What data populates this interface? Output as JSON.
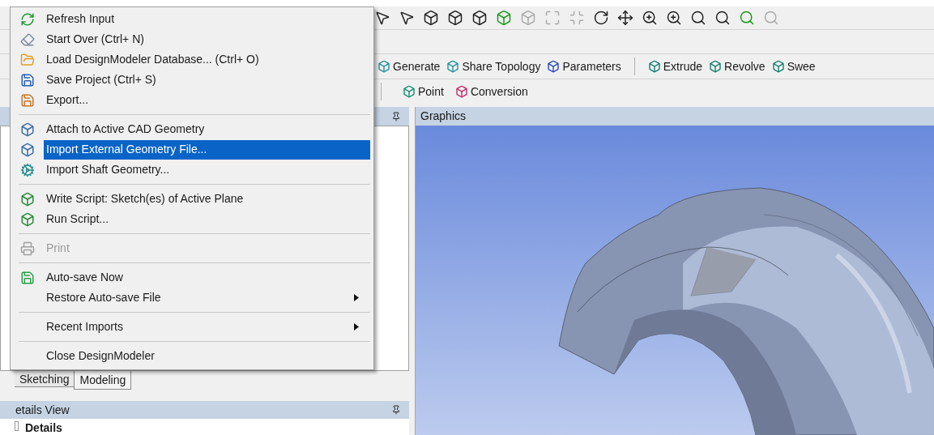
{
  "menu": {
    "items": [
      {
        "kind": "item",
        "label": "Refresh Input",
        "selected": false,
        "disabled": false,
        "submenu": false
      },
      {
        "kind": "item",
        "label": "Start Over (Ctrl+ N)",
        "selected": false,
        "disabled": false,
        "submenu": false
      },
      {
        "kind": "item",
        "label": "Load DesignModeler Database... (Ctrl+ O)",
        "selected": false,
        "disabled": false,
        "submenu": false
      },
      {
        "kind": "item",
        "label": "Save Project (Ctrl+ S)",
        "selected": false,
        "disabled": false,
        "submenu": false
      },
      {
        "kind": "item",
        "label": "Export...",
        "selected": false,
        "disabled": false,
        "submenu": false
      },
      {
        "kind": "separator"
      },
      {
        "kind": "item",
        "label": "Attach to Active CAD Geometry",
        "selected": false,
        "disabled": false,
        "submenu": false
      },
      {
        "kind": "item",
        "label": "Import External Geometry File...",
        "selected": true,
        "disabled": false,
        "submenu": false
      },
      {
        "kind": "item",
        "label": "Import Shaft Geometry...",
        "selected": false,
        "disabled": false,
        "submenu": false
      },
      {
        "kind": "separator"
      },
      {
        "kind": "item",
        "label": "Write Script: Sketch(es) of Active Plane",
        "selected": false,
        "disabled": false,
        "submenu": false
      },
      {
        "kind": "item",
        "label": "Run Script...",
        "selected": false,
        "disabled": false,
        "submenu": false
      },
      {
        "kind": "separator"
      },
      {
        "kind": "item",
        "label": "Print",
        "selected": false,
        "disabled": true,
        "submenu": false
      },
      {
        "kind": "separator"
      },
      {
        "kind": "item",
        "label": "Auto-save Now",
        "selected": false,
        "disabled": false,
        "submenu": false
      },
      {
        "kind": "item",
        "label": "Restore Auto-save File",
        "selected": false,
        "disabled": false,
        "submenu": true
      },
      {
        "kind": "separator"
      },
      {
        "kind": "item",
        "label": "Recent Imports",
        "selected": false,
        "disabled": false,
        "submenu": true
      },
      {
        "kind": "separator"
      },
      {
        "kind": "item",
        "label": "Close DesignModeler",
        "selected": false,
        "disabled": false,
        "submenu": false
      }
    ]
  },
  "feature_toolbar": [
    "Generate",
    "Share Topology",
    "Parameters"
  ],
  "create_toolbar": [
    "Extrude",
    "Revolve",
    "Swee"
  ],
  "sketch_toolbar": [
    "Point",
    "Conversion"
  ],
  "graphics_panel": {
    "title": "Graphics"
  },
  "tabs": [
    {
      "label": "Sketching",
      "selected": false
    },
    {
      "label": "Modeling",
      "selected": true
    }
  ],
  "details_view": {
    "title": "etails View",
    "header": "Details"
  }
}
